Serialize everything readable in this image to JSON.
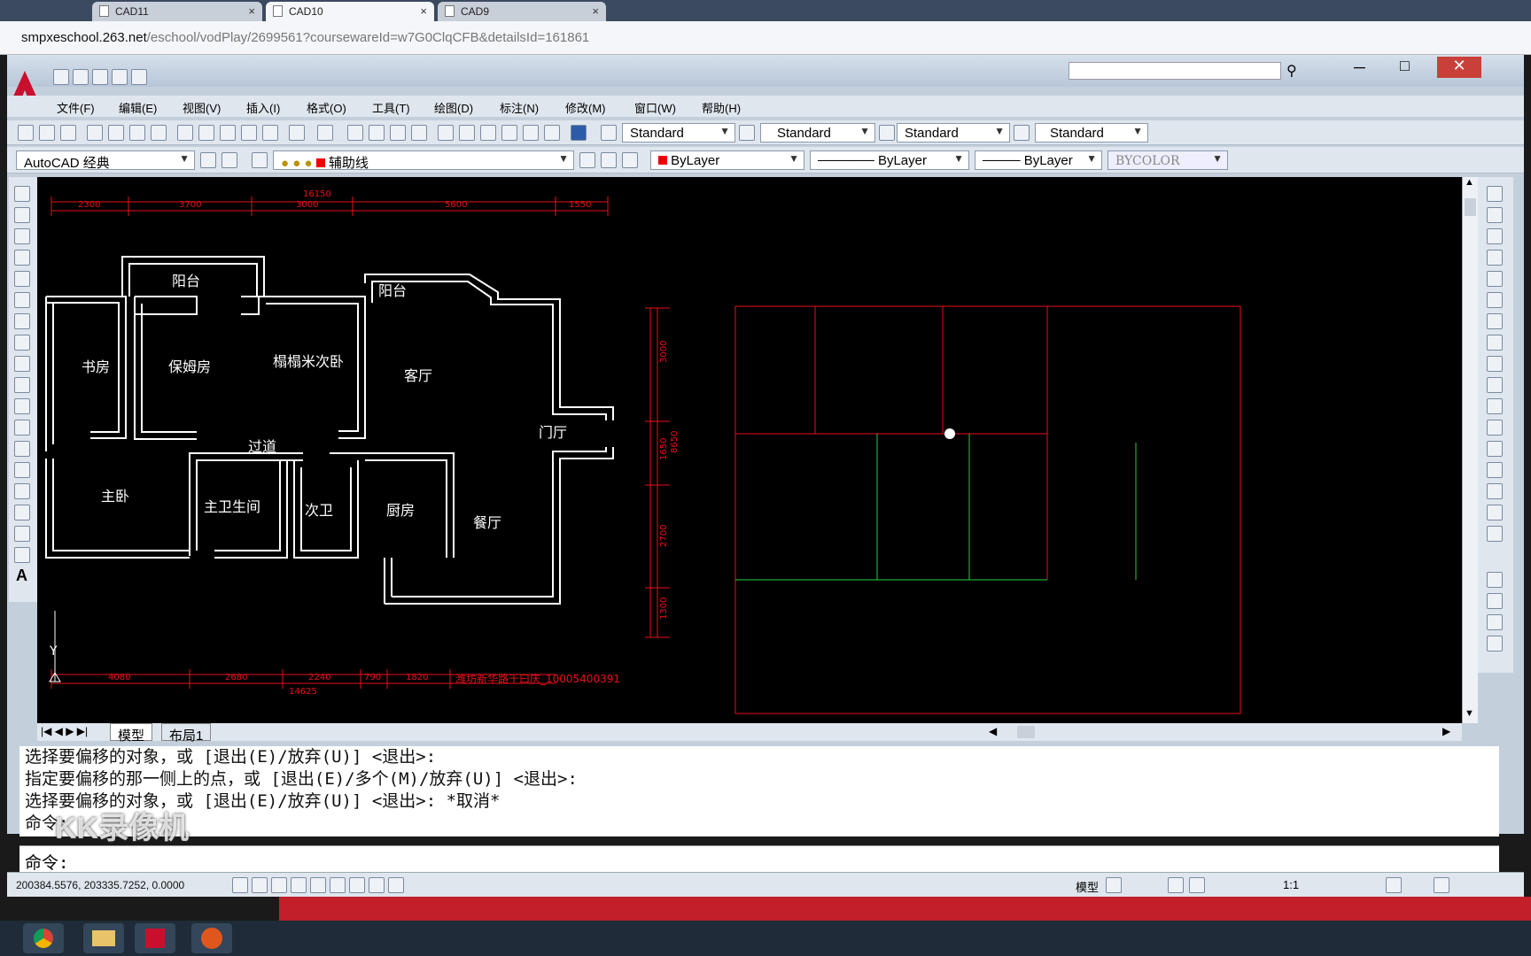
{
  "browser": {
    "tabs": [
      {
        "label": "CAD11"
      },
      {
        "label": "CAD10"
      },
      {
        "label": "CAD9"
      }
    ],
    "url_host": "smpxeschool.263.net",
    "url_path": "/eschool/vodPlay/2699561?coursewareId=w7G0ClqCFB&detailsId=161861"
  },
  "menu": [
    "文件(F)",
    "编辑(E)",
    "视图(V)",
    "插入(I)",
    "格式(O)",
    "工具(T)",
    "绘图(D)",
    "标注(N)",
    "修改(M)",
    "窗口(W)",
    "帮助(H)"
  ],
  "toolbar": {
    "text_style": "Standard",
    "dim_style": "Standard",
    "table_style": "Standard",
    "mleader_style": "Standard",
    "workspace": "AutoCAD 经典",
    "layer": "辅助线",
    "color": "ByLayer",
    "linetype": "ByLayer",
    "lineweight": "ByLayer",
    "plotstyle": "BYCOLOR"
  },
  "drawing": {
    "top_total": "16150",
    "top_dims": [
      "2300",
      "3700",
      "3000",
      "5600",
      "1550"
    ],
    "bottom_total": "14625",
    "bottom_dims": [
      "4080",
      "2680",
      "2240",
      "790",
      "1820"
    ],
    "right_total": "8650",
    "right_dims": [
      "3000",
      "1650",
      "2700",
      "1300"
    ],
    "rooms": [
      "阳台",
      "阳台",
      "书房",
      "保姆房",
      "榻榻米次卧",
      "客厅",
      "过道",
      "门厅",
      "主卧",
      "主卫生间",
      "次卫",
      "厨房",
      "餐厅"
    ],
    "watermark": "潍坊新华路千曰庆_10005400391",
    "ucs_y": "Y"
  },
  "layout_tabs": [
    "模型",
    "布局1"
  ],
  "command_history": [
    "选择要偏移的对象，或 [退出(E)/放弃(U)] <退出>:",
    "指定要偏移的那一侧上的点，或 [退出(E)/多个(M)/放弃(U)] <退出>:",
    "选择要偏移的对象，或 [退出(E)/放弃(U)] <退出>:  *取消*",
    "命令:"
  ],
  "command_prompt": "命令:",
  "overlay_watermark": "KK录像机",
  "status": {
    "coords": "200384.5576, 203335.7252, 0.0000",
    "model": "模型",
    "scale": "1:1"
  },
  "colors": {
    "dim": "#e8101a",
    "wall": "#ffffff",
    "green": "#1faa3a",
    "bg": "#000000"
  }
}
